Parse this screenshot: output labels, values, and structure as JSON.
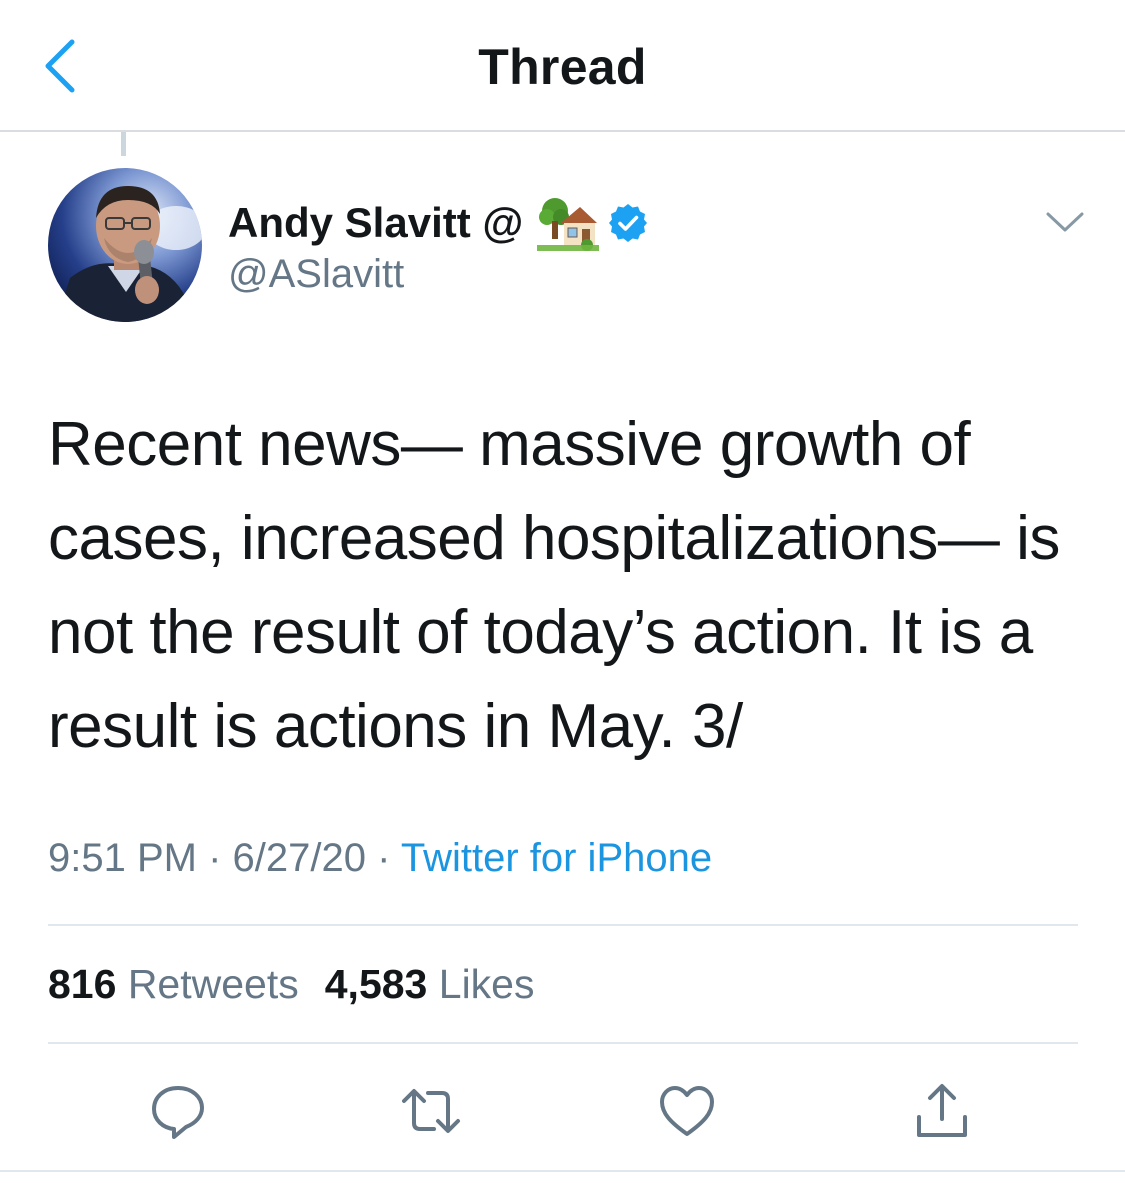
{
  "header": {
    "title": "Thread",
    "back_icon": "chevron-left-icon"
  },
  "tweet": {
    "display_name": "Andy Slavitt @",
    "name_emoji": "house-with-garden-icon",
    "verified": true,
    "handle": "@ASlavitt",
    "text": "Recent news— massive growth of cases, increased hospitalizations— is not the result of today’s action.  It is a result is actions in May. 3/",
    "time": "9:51 PM",
    "date": "6/27/20",
    "separator": "·",
    "source": "Twitter for iPhone",
    "retweets_count": "816",
    "retweets_label": "Retweets",
    "likes_count": "4,583",
    "likes_label": "Likes"
  },
  "actions": [
    "reply-icon",
    "retweet-icon",
    "like-icon",
    "share-icon"
  ],
  "colors": {
    "accent": "#1da1f2",
    "link": "#1b95e0",
    "secondary_text": "#657786",
    "primary_text": "#14171a",
    "divider": "#e1e8ed"
  }
}
